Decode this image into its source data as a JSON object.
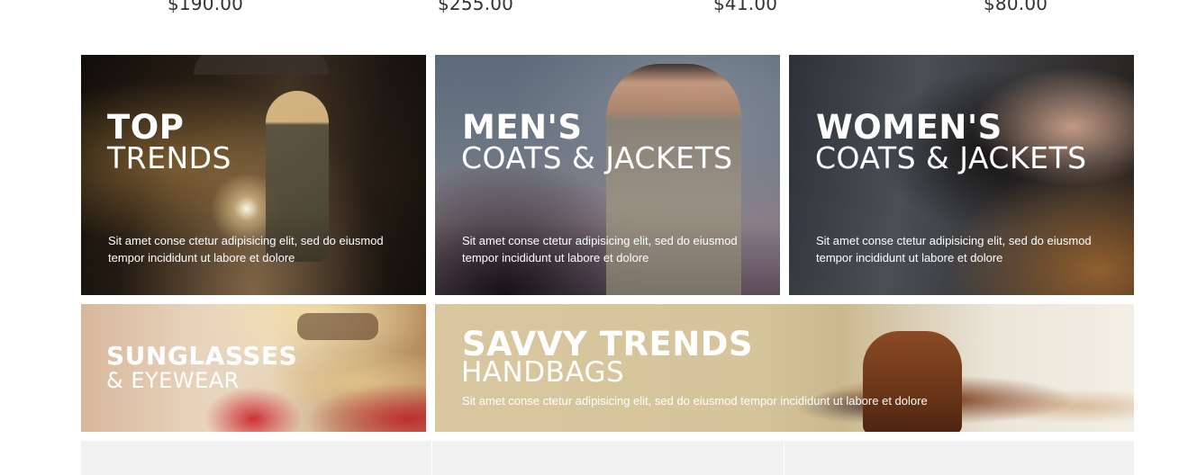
{
  "prices": [
    "$190.00",
    "$255.00",
    "$41.00",
    "$80.00"
  ],
  "tiles": {
    "top_trends": {
      "title": "TOP",
      "subtitle": "TRENDS",
      "desc_line1": "Sit amet conse ctetur adipisicing elit, sed do eiusmod",
      "desc_line2": "tempor incididunt ut labore et dolore"
    },
    "mens": {
      "title": "MEN'S",
      "subtitle": "COATS & JACKETS",
      "desc_line1": "Sit amet conse ctetur adipisicing elit, sed do eiusmod",
      "desc_line2": "tempor incididunt ut labore et dolore"
    },
    "womens": {
      "title": "WOMEN'S",
      "subtitle": "COATS & JACKETS",
      "desc_line1": "Sit amet conse ctetur adipisicing elit, sed do eiusmod",
      "desc_line2": "tempor incididunt ut labore et dolore"
    },
    "sunglasses": {
      "title": "SUNGLASSES",
      "subtitle": "& EYEWEAR"
    },
    "handbags": {
      "title": "SAVVY TRENDS",
      "subtitle": "HANDBAGS",
      "desc": "Sit amet conse ctetur adipisicing elit, sed do eiusmod tempor incididunt ut labore et dolore"
    }
  },
  "colors": {
    "text_dark": "#333333",
    "strip_bg": "#f1f1f1",
    "overlay_text": "#ffffff"
  }
}
